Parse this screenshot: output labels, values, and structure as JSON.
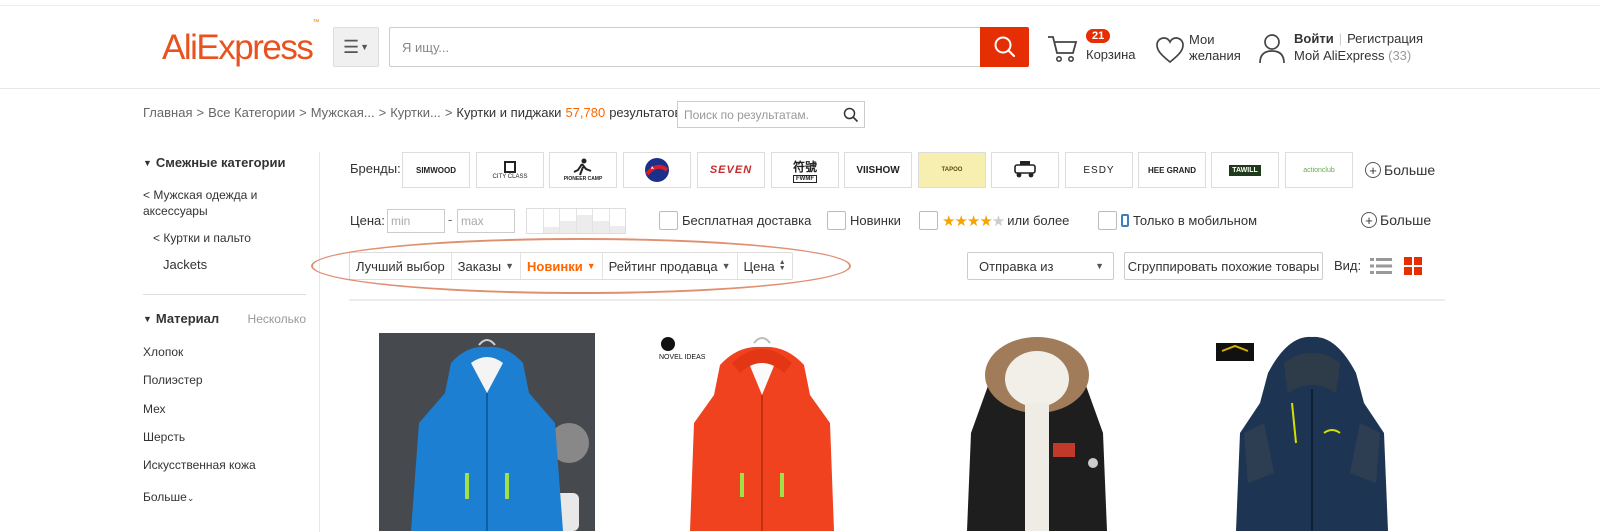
{
  "header": {
    "logo_main": "AliExpress",
    "logo_tm": "™",
    "search_placeholder": "Я ищу...",
    "cart_count": "21",
    "cart_label": "Корзина",
    "wishlist_label": "Мои желания",
    "login": "Войти",
    "register": "Регистрация",
    "my_account": "Мой AliExpress",
    "my_account_count": "(33)"
  },
  "breadcrumb": {
    "items": [
      "Главная",
      "Все Категории",
      "Мужская...",
      "Куртки..."
    ],
    "current": "Куртки и пиджаки",
    "count": "57,780",
    "results": "результатов",
    "separator": ">",
    "search_placeholder": "Поиск по результатам."
  },
  "sidebar": {
    "related_title": "Смежные категории",
    "cat_parent": "< Мужская одежда и аксессуары",
    "cat_sub": "< Куртки и пальто",
    "cat_current": "Jackets",
    "material_title": "Материал",
    "material_multi": "Несколько",
    "materials": [
      "Хлопок",
      "Полиэстер",
      "Мех",
      "Шерсть",
      "Искусственная кожа"
    ],
    "more": "Больше"
  },
  "filters": {
    "brands_label": "Бренды:",
    "brands": [
      "SIMWOOD",
      "CITY CLASS",
      "PIONEER CAMP",
      "",
      "SEVEN",
      "",
      "VIISHOW",
      "TAPOO",
      "",
      "ESDY",
      "HEE GRAND",
      "TAWILL",
      "actionclub"
    ],
    "more": "Больше",
    "price_label": "Цена:",
    "price_min_placeholder": "min",
    "price_max_placeholder": "max",
    "price_bar_levels": [
      0.0,
      0.25,
      0.5,
      0.75,
      0.5,
      0.3
    ],
    "free_shipping": "Бесплатная доставка",
    "new_items": "Новинки",
    "rating_stars": "★★★★",
    "rating_star_off": "★",
    "rating_suffix": "или более",
    "mobile_only": "Только в мобильном"
  },
  "sort": {
    "items": [
      "Лучший выбор",
      "Заказы",
      "Новинки",
      "Рейтинг продавца",
      "Цена"
    ],
    "active_index": 2,
    "ship_from": "Отправка из",
    "group_similar": "Сгруппировать похожие товары",
    "view_label": "Вид:"
  },
  "products": [
    {
      "icon": "blue-jacket-image"
    },
    {
      "icon": "red-jacket-image",
      "brand_label": "NOVEL IDEAS"
    },
    {
      "icon": "black-fur-parka-image"
    },
    {
      "icon": "navy-softshell-jacket-image"
    }
  ],
  "colors": {
    "accent": "#e62e04",
    "orange": "#ff6600",
    "logo_orange": "#f07c00",
    "highlight_ellipse": "#e09070"
  }
}
